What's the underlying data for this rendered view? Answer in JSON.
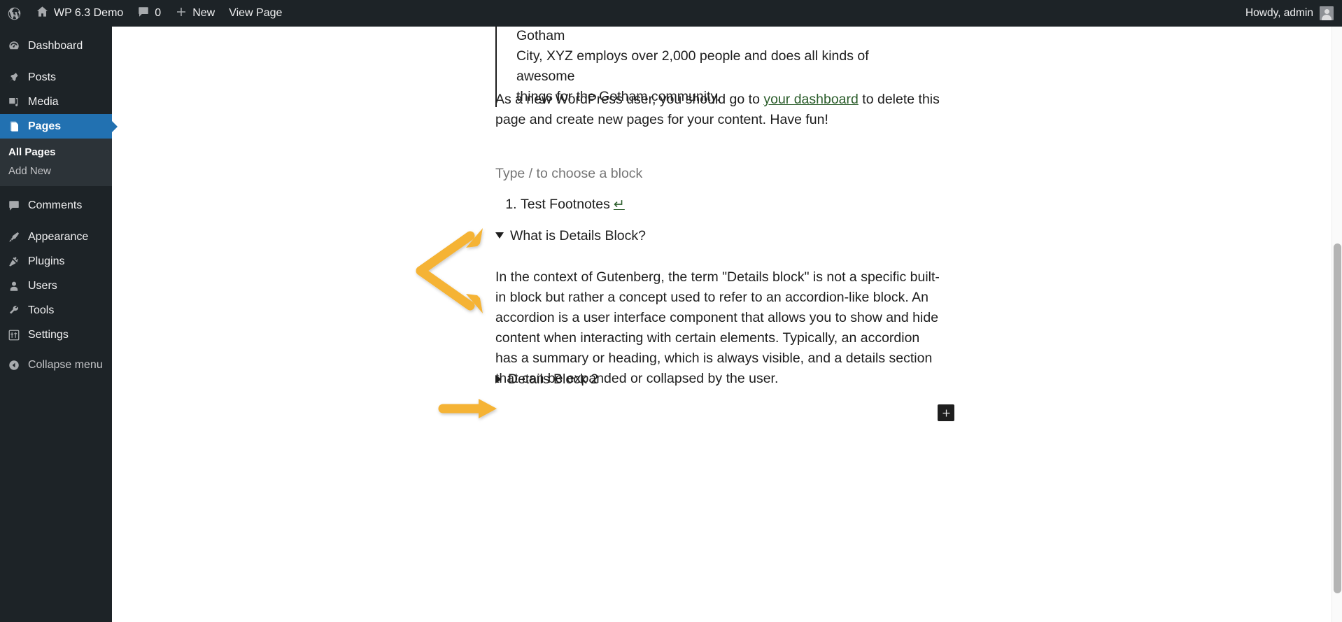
{
  "adminbar": {
    "logo_icon": "wordpress-logo-icon",
    "site_icon": "home-icon",
    "site_name": "WP 6.3 Demo",
    "comments_icon": "comment-bubble-icon",
    "comments_count": "0",
    "new_icon": "plus-icon",
    "new_label": "New",
    "view_page_label": "View Page",
    "howdy": "Howdy, admin",
    "avatar_icon": "user-avatar-icon"
  },
  "sidebar": {
    "items": [
      {
        "label": "Dashboard",
        "icon": "dashboard-icon",
        "current": false
      },
      {
        "label": "Posts",
        "icon": "pin-icon",
        "current": false
      },
      {
        "label": "Media",
        "icon": "media-icon",
        "current": false
      },
      {
        "label": "Pages",
        "icon": "pages-icon",
        "current": true
      },
      {
        "label": "Comments",
        "icon": "comment-bubble-icon",
        "current": false
      },
      {
        "label": "Appearance",
        "icon": "paintbrush-icon",
        "current": false
      },
      {
        "label": "Plugins",
        "icon": "plug-icon",
        "current": false
      },
      {
        "label": "Users",
        "icon": "user-icon",
        "current": false
      },
      {
        "label": "Tools",
        "icon": "wrench-icon",
        "current": false
      },
      {
        "label": "Settings",
        "icon": "sliders-icon",
        "current": false
      }
    ],
    "submenu": [
      {
        "label": "All Pages",
        "active": true
      },
      {
        "label": "Add New",
        "active": false
      }
    ],
    "collapse": {
      "label": "Collapse menu",
      "icon": "collapse-arrow-icon"
    }
  },
  "editor": {
    "quote": {
      "line1": "providing quality doohickeys to the public ever since. Located in Gotham",
      "line2": "City, XYZ employs over 2,000 people and does all kinds of awesome",
      "line3": "things for the Gotham community."
    },
    "dashboard_paragraph": {
      "before_link": "As a new WordPress user, you should go to ",
      "link_text": "your dashboard",
      "after_link": " to delete this page and create new pages for your content. Have fun!"
    },
    "empty_block_placeholder": "Type / to choose a block",
    "ordered_list": {
      "items": [
        {
          "text": "Test Footnotes",
          "backlink_icon": "return-arrow-icon",
          "backlink_glyph": "↵"
        }
      ]
    },
    "details_blocks": [
      {
        "summary": "What is Details Block?",
        "state": "open",
        "toggle_icon": "triangle-down-icon",
        "body": "In the context of Gutenberg, the term \"Details block\" is not a specific built-in block but rather a concept used to refer to an accordion-like block. An accordion is a user interface component that allows you to show and hide content when interacting with certain elements. Typically, an accordion has a summary or heading, which is always visible, and a details section that can be expanded or collapsed by the user."
      },
      {
        "summary": "Details Block 2",
        "state": "closed",
        "toggle_icon": "triangle-right-icon",
        "body": ""
      }
    ],
    "inserter": {
      "icon": "plus-icon",
      "label": "+"
    }
  },
  "annotations": {
    "color": "#f5b335",
    "arrows": [
      {
        "name": "double-arrow-to-details-block-1",
        "shape": "v-double-headed-arrow"
      },
      {
        "name": "arrow-to-details-block-2",
        "shape": "single-right-arrow"
      }
    ]
  },
  "scrollbar": {
    "name": "vertical-scrollbar"
  },
  "colors": {
    "admin_dark": "#1d2327",
    "admin_highlight": "#2271b1",
    "link_green": "#2b5d2b",
    "annotation_yellow": "#f5b335",
    "text": "#1e1e1e",
    "placeholder": "#757575"
  }
}
